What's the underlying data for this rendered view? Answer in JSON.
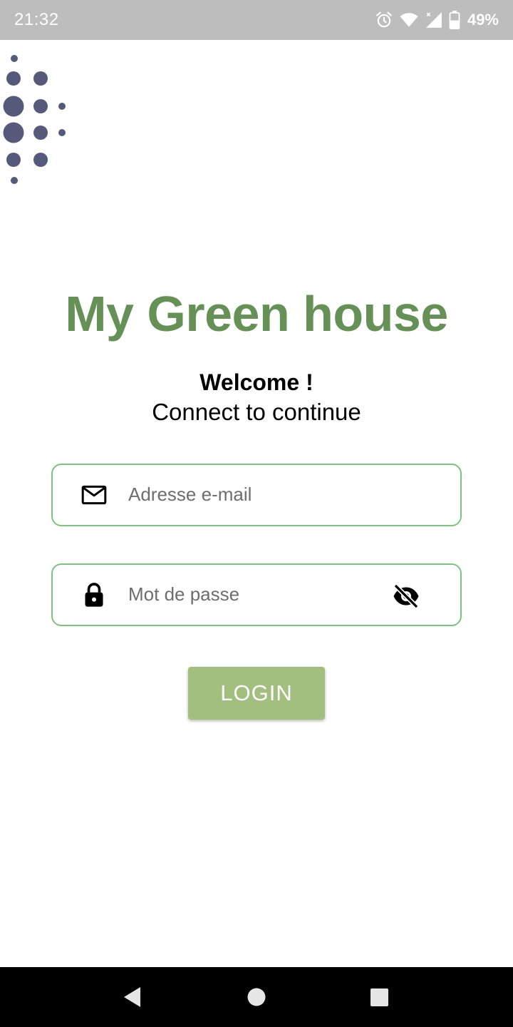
{
  "status_bar": {
    "time": "21:32",
    "battery": "49%",
    "icons": [
      "alarm-icon",
      "wifi-icon",
      "signal-icon",
      "battery-icon"
    ]
  },
  "logo": {
    "icon": "dots-logo-icon",
    "color": "#555a7a"
  },
  "header": {
    "title": "My Green house",
    "welcome": "Welcome !",
    "subtitle": "Connect to continue"
  },
  "form": {
    "email": {
      "icon": "mail-icon",
      "placeholder": "Adresse e-mail",
      "value": ""
    },
    "password": {
      "icon": "lock-icon",
      "placeholder": "Mot de passe",
      "value": "",
      "toggle_icon": "eye-off-icon"
    },
    "login_label": "LOGIN"
  },
  "nav_bar": {
    "icons": [
      "back-icon",
      "home-icon",
      "recents-icon"
    ]
  },
  "colors": {
    "title": "#659157",
    "field_border": "#7bc47f",
    "button": "#a3bf7f",
    "status_bar": "#bdbdbd",
    "nav_bar": "#000000"
  }
}
